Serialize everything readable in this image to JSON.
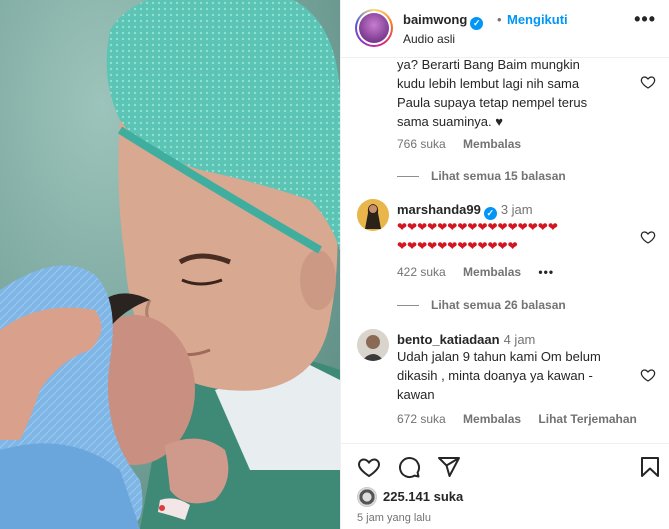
{
  "post": {
    "username": "baimwong",
    "separator": "•",
    "follow_status": "Mengikuti",
    "audio": "Audio asli",
    "more": "•••"
  },
  "comments": [
    {
      "text_lines": [
        "ya? Berarti Bang Baim mungkin",
        "kudu lebih lembut lagi nih sama",
        "Paula supaya tetap nempel terus",
        "sama suaminya. ♥"
      ],
      "likes": "766 suka",
      "reply": "Membalas",
      "view_replies": "Lihat semua 15 balasan"
    },
    {
      "username": "marshanda99",
      "time": "3 jam",
      "text_lines": [
        "❤❤❤❤❤❤❤❤❤❤❤❤❤❤❤❤",
        "❤❤❤❤❤❤❤❤❤❤❤❤"
      ],
      "likes": "422 suka",
      "reply": "Membalas",
      "more": "•••",
      "view_replies": "Lihat semua 26 balasan"
    },
    {
      "username": "bento_katiadaan",
      "time": "4 jam",
      "text_lines": [
        "Udah jalan 9 tahun kami Om belum",
        "dikasih , minta doanya ya kawan -",
        "kawan"
      ],
      "likes": "672 suka",
      "reply": "Membalas",
      "translate": "Lihat Terjemahan"
    }
  ],
  "actions": {
    "like_icon": "heart-icon",
    "comment_icon": "comment-icon",
    "share_icon": "share-icon",
    "save_icon": "bookmark-icon"
  },
  "likes_total": "225.141 suka",
  "time_ago": "5 jam yang lalu",
  "colors": {
    "link": "#0095f6",
    "muted": "#737373",
    "text": "#262626",
    "heart": "#d4141e"
  }
}
